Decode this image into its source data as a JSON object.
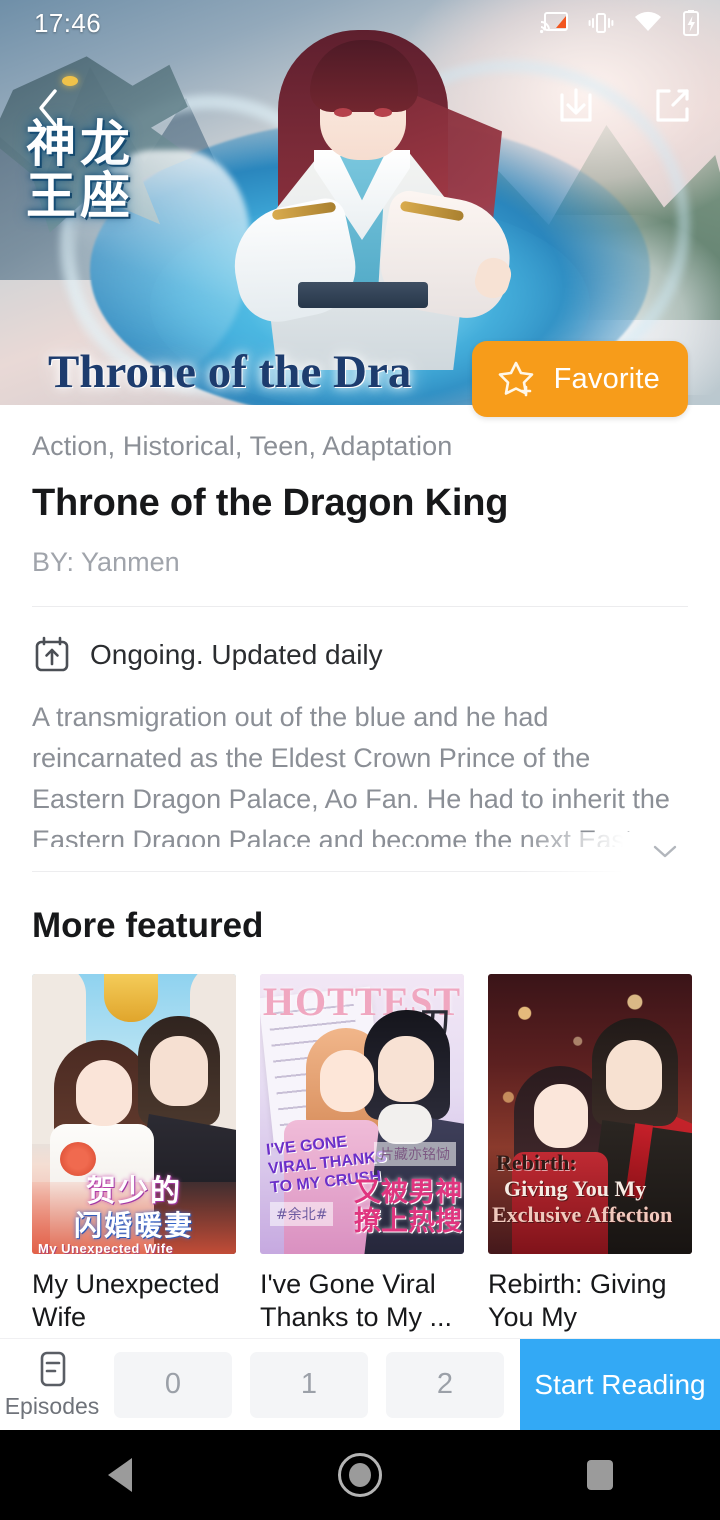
{
  "status_bar": {
    "time": "17:46",
    "icons": [
      "cast-icon",
      "vibrate-icon",
      "wifi-icon",
      "battery-charging-icon"
    ]
  },
  "hero": {
    "back_icon": "chevron-left-icon",
    "download_icon": "download-icon",
    "share_icon": "share-external-icon",
    "cn_title_chars": [
      "神",
      "龙",
      "王",
      "座"
    ],
    "banner_title": "Throne of the Dra",
    "favorite_label": "Favorite",
    "favorite_icon": "star-plus-icon",
    "favorite_color": "#F79C1A"
  },
  "info": {
    "genres": "Action, Historical, Teen, Adaptation",
    "title": "Throne of the Dragon King",
    "author": "BY: Yanmen"
  },
  "status": {
    "icon": "calendar-up-icon",
    "text": "Ongoing. Updated daily",
    "description": "A transmigration out of the blue and he had reincarnated as the Eldest Crown Prince of the Eastern Dragon Palace, Ao Fan. He had to inherit the Eastern Dragon Palace and become the next Eastern Drag",
    "expand_icon": "chevron-down-icon"
  },
  "featured": {
    "heading": "More featured",
    "cards": [
      {
        "title": "My Unexpected Wife",
        "cover_cn_line1": "贺少的",
        "cover_cn_line2": "闪婚暖妻",
        "cover_en": "My Unexpected Wife"
      },
      {
        "title": "I've Gone Viral Thanks to My ...",
        "cover_badge": "HOTTEST",
        "cover_cn_vertical": "刀笔",
        "cover_en": "I'VE GONE VIRAL THANKS TO MY CRUSH",
        "cover_cn_line2": "又被男神撩上热搜",
        "cover_tag_left": "#余北#",
        "cover_tag_right": "片藏亦铭恸"
      },
      {
        "title": "Rebirth: Giving You My Exclusi...",
        "cover_line1": "Rebirth:",
        "cover_line2": "Giving You My",
        "cover_line3": "Exclusive Affection"
      }
    ]
  },
  "bottom_bar": {
    "episodes_icon": "episode-list-icon",
    "episodes_label": "Episodes",
    "chips": [
      "0",
      "1",
      "2"
    ],
    "start_label": "Start Reading",
    "start_color": "#33A9F5"
  },
  "nav_bar": {
    "back_icon": "nav-back-triangle-icon",
    "home_icon": "nav-home-circle-icon",
    "recents_icon": "nav-recents-square-icon"
  }
}
